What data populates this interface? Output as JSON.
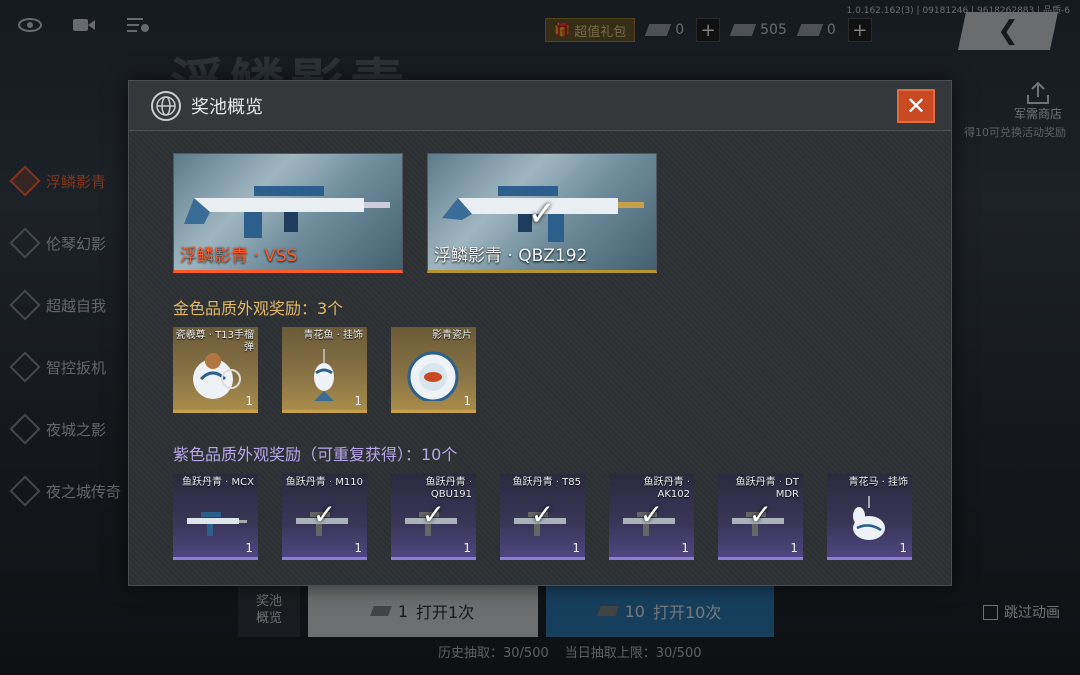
{
  "background": {
    "banner": "浮鳞影青",
    "version": "1.0.162.162(3) | 09181246 | 9618262883 | 品质-6",
    "gift_label": "超值礼包",
    "currencies": [
      {
        "name": "ticket-icon",
        "value": "0"
      },
      {
        "name": "bar-icon",
        "value": "505"
      },
      {
        "name": "card-icon",
        "value": "0"
      }
    ],
    "back_icon": "chevron-left-icon",
    "shop_label": "军需商店",
    "shop_note": "得10可兑换活动奖励",
    "sidebar": [
      {
        "label": "浮鳞影青",
        "active": true
      },
      {
        "label": "伦琴幻影",
        "active": false
      },
      {
        "label": "超越自我",
        "active": false
      },
      {
        "label": "智控扳机",
        "active": false
      },
      {
        "label": "夜城之影",
        "active": false
      },
      {
        "label": "夜之城传奇",
        "active": false
      }
    ],
    "pool_button": {
      "line1": "奖池",
      "line2": "概览"
    },
    "open_one": {
      "count": "1",
      "label": "打开1次"
    },
    "open_ten": {
      "count": "10",
      "label": "打开10次"
    },
    "skip_label": "跳过动画",
    "history_draws": "历史抽取：30/500",
    "daily_limit": "当日抽取上限：30/500"
  },
  "modal": {
    "title": "奖池概览",
    "close_icon": "close-icon",
    "weapons": [
      {
        "name": "浮鳞影青 · VSS",
        "selected": true,
        "owned": false
      },
      {
        "name": "浮鳞影青 · QBZ192",
        "selected": false,
        "owned": true
      }
    ],
    "gold_section_title": "金色品质外观奖励：3个",
    "gold_items": [
      {
        "name": "瓷羲尊 · T13手榴弹",
        "count": "1",
        "owned": false,
        "icon": "grenade-icon"
      },
      {
        "name": "青花鱼 · 挂饰",
        "count": "1",
        "owned": false,
        "icon": "fish-charm-icon"
      },
      {
        "name": "影青瓷片",
        "count": "1",
        "owned": false,
        "icon": "porcelain-plate-icon"
      }
    ],
    "purple_section_title": "紫色品质外观奖励（可重复获得）：10个",
    "purple_items": [
      {
        "name": "鱼跃丹青 · MCX",
        "count": "1",
        "owned": false,
        "icon": "rifle-icon"
      },
      {
        "name": "鱼跃丹青 · M110",
        "count": "1",
        "owned": true,
        "icon": "rifle-icon"
      },
      {
        "name": "鱼跃丹青 · QBU191",
        "count": "1",
        "owned": true,
        "icon": "rifle-icon"
      },
      {
        "name": "鱼跃丹青 · T85",
        "count": "1",
        "owned": true,
        "icon": "rifle-icon"
      },
      {
        "name": "鱼跃丹青 · AK102",
        "count": "1",
        "owned": true,
        "icon": "rifle-icon"
      },
      {
        "name": "鱼跃丹青 · DT MDR",
        "count": "1",
        "owned": true,
        "icon": "rifle-icon"
      },
      {
        "name": "青花马 · 挂饰",
        "count": "1",
        "owned": false,
        "icon": "horse-charm-icon"
      }
    ],
    "colors": {
      "selected": "#ff5a28",
      "gold": "#e2b864",
      "purple": "#b8a6ec",
      "close_bg": "#c94a22"
    }
  }
}
